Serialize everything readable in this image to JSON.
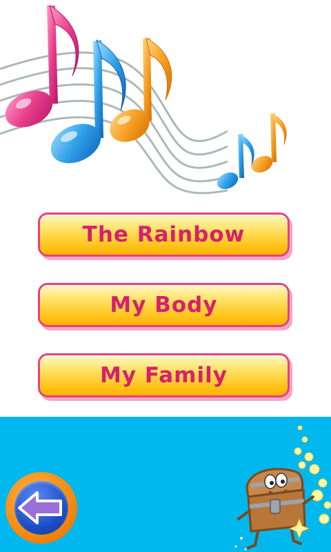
{
  "menu": {
    "items": [
      {
        "label": "The Rainbow"
      },
      {
        "label": "My Body"
      },
      {
        "label": "My Family"
      }
    ]
  },
  "icons": {
    "back": "back-arrow-icon",
    "notes": "music-notes-icon",
    "mascot": "treasure-chest-icon"
  },
  "colors": {
    "button_text": "#d6206d",
    "button_border": "#e8407e",
    "button_fill": "#ffd43a",
    "panel": "#00b7ee",
    "back_ring": "#f58a10",
    "back_disc": "#1e4fc8",
    "arrow": "#9b6fd8"
  }
}
